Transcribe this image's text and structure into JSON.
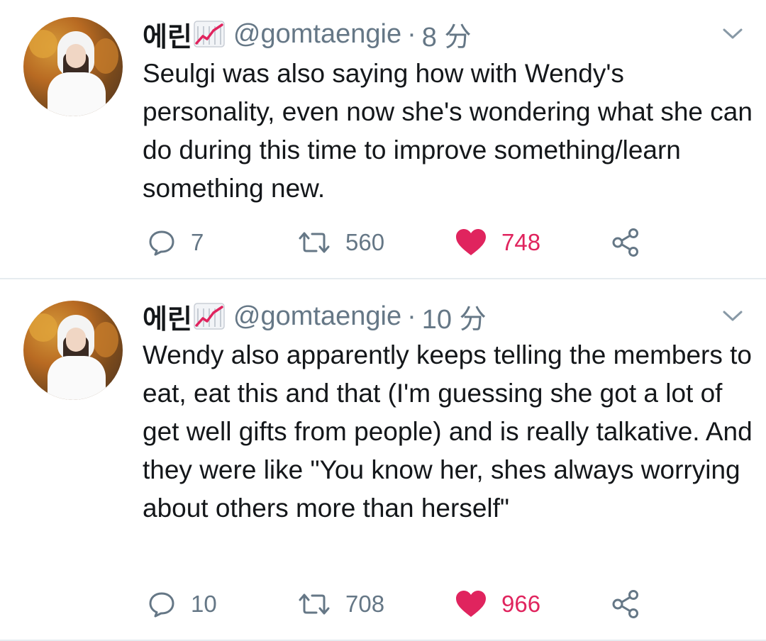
{
  "colors": {
    "text": "#14171a",
    "secondary": "#657786",
    "like": "#e0245e",
    "divider": "#e6ecf0"
  },
  "tweets": [
    {
      "name": "에린",
      "handle": "@gomtaengie",
      "separator": "·",
      "time": "8 分",
      "text": "Seulgi was also saying how with Wendy's personality, even now she's wondering what she can do during this time to improve something/learn something new.",
      "replies": "7",
      "retweets": "560",
      "likes": "748"
    },
    {
      "name": "에린",
      "handle": "@gomtaengie",
      "separator": "·",
      "time": "10 分",
      "text": "Wendy also apparently keeps telling the members to eat, eat this and that (I'm guessing she got a lot of get well gifts from people) and is really talkative. And they were like \"You know her, shes always worrying about others more than herself\"",
      "replies": "10",
      "retweets": "708",
      "likes": "966"
    }
  ]
}
